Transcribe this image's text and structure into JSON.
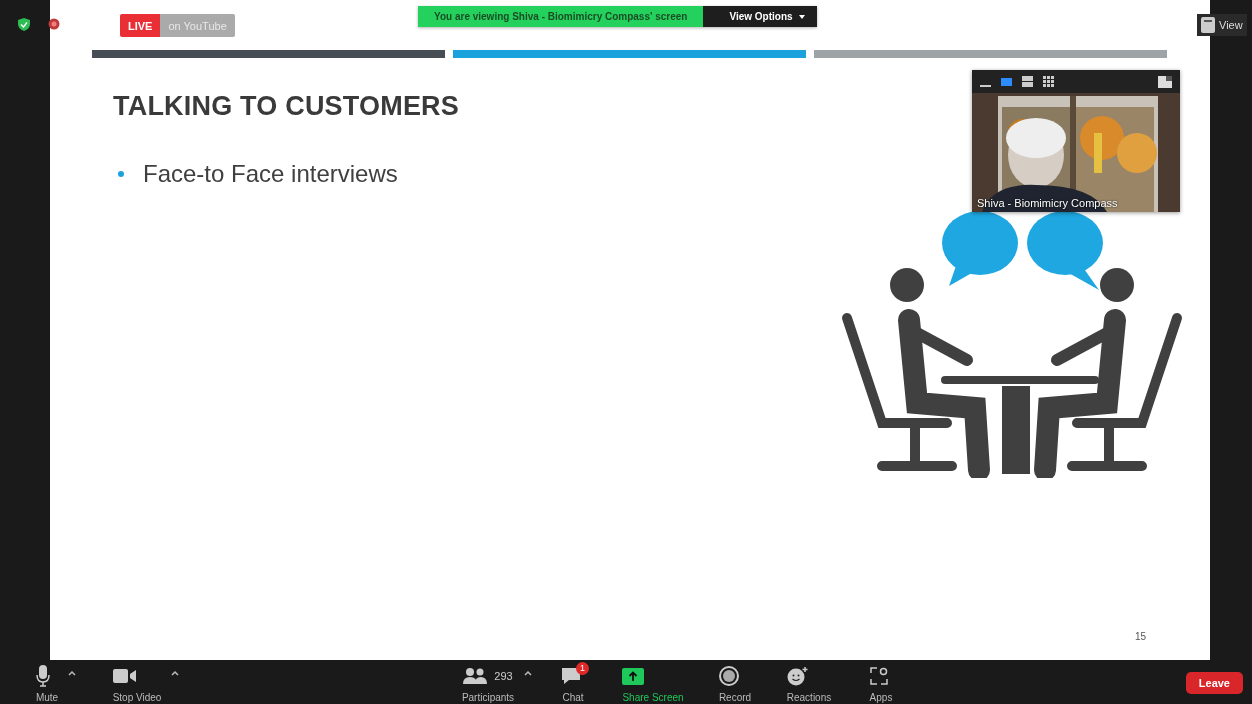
{
  "live_badge": {
    "label": "LIVE",
    "platform": "on YouTube"
  },
  "share_banner": {
    "text": "You are viewing Shiva - Biomimicry Compass' screen",
    "options": "View Options"
  },
  "view_button": {
    "label": "View"
  },
  "slide": {
    "title": "TALKING TO CUSTOMERS",
    "bullets": [
      "Face-to Face interviews"
    ],
    "page_number": "15"
  },
  "video_panel": {
    "layout_buttons": [
      {
        "kind": "minimize",
        "selected": false
      },
      {
        "kind": "speaker",
        "selected": true
      },
      {
        "kind": "strip",
        "selected": false
      },
      {
        "kind": "grid",
        "selected": false
      }
    ],
    "participant_name": "Shiva - Biomimicry Compass"
  },
  "toolbar": {
    "left": [
      {
        "kind": "mic",
        "label": "Mute",
        "caret": true
      },
      {
        "kind": "video",
        "label": "Stop Video",
        "caret": true
      }
    ],
    "center": [
      {
        "kind": "participants",
        "label": "Participants",
        "count": "293",
        "caret": true,
        "highlighted": false
      },
      {
        "kind": "chat",
        "label": "Chat",
        "badge": "1",
        "highlighted": false
      },
      {
        "kind": "share",
        "label": "Share Screen",
        "highlighted": true
      },
      {
        "kind": "record",
        "label": "Record",
        "highlighted": false
      },
      {
        "kind": "reactions",
        "label": "Reactions",
        "highlighted": false
      },
      {
        "kind": "apps",
        "label": "Apps",
        "highlighted": false
      }
    ],
    "leave": "Leave"
  }
}
